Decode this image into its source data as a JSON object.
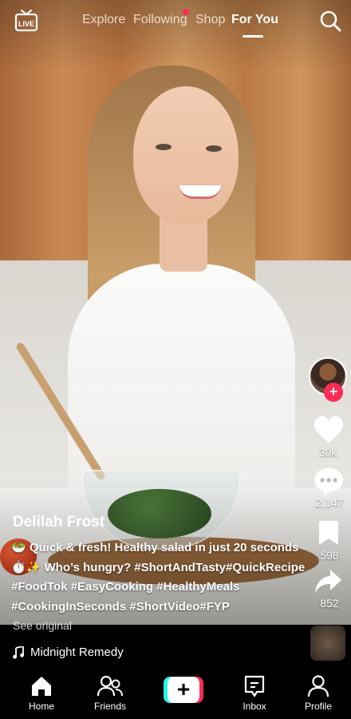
{
  "topnav": {
    "live_label": "LIVE",
    "tabs": [
      "Explore",
      "Following",
      "Shop",
      "For You"
    ],
    "active_tab": "For You"
  },
  "rail": {
    "likes": "30k",
    "comments": "2,147",
    "saves": "598",
    "shares": "852",
    "follow_symbol": "+"
  },
  "post": {
    "author": "Delilah Frost",
    "caption_lines": [
      "🥗 Quick & fresh! Healthy salad in just 20 seconds",
      "⏱️✨ Who’s hungry? #ShortAndTasty#QuickRecipe",
      "#FoodTok #EasyCooking #HealthyMeals",
      "#CookingInSeconds #ShortVideo#FYP"
    ],
    "see_original": "See original",
    "music_title": "Midnight Remedy"
  },
  "bottombar": {
    "home": "Home",
    "friends": "Friends",
    "create_symbol": "+",
    "inbox": "Inbox",
    "profile": "Profile"
  },
  "colors": {
    "accent": "#fe2c55",
    "cyan": "#25f4ee",
    "background": "#000000"
  },
  "icons": [
    "live-icon",
    "search-icon",
    "heart-icon",
    "comment-icon",
    "bookmark-icon",
    "share-icon",
    "music-note-icon",
    "home-icon",
    "friends-icon",
    "create-icon",
    "inbox-icon",
    "profile-icon"
  ]
}
